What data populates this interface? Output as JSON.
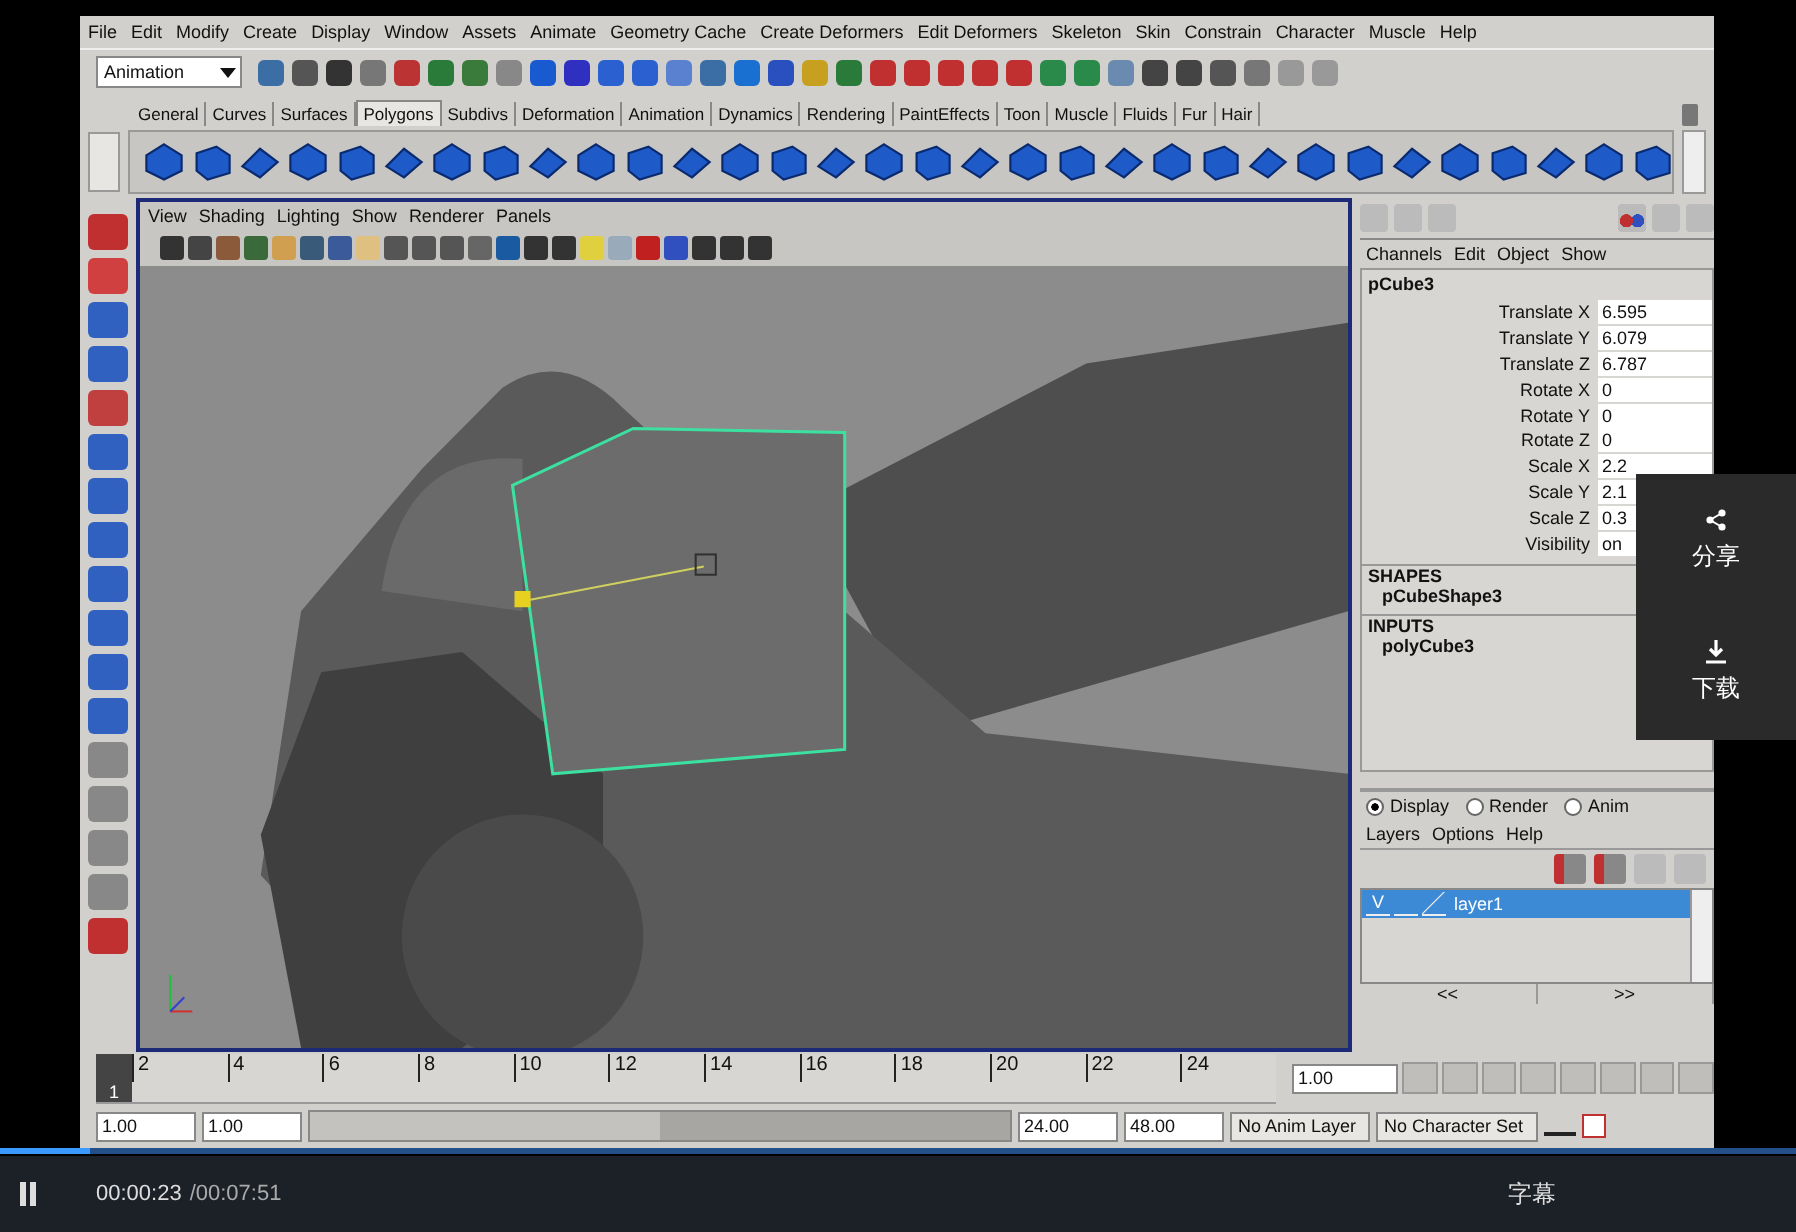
{
  "menu_bar": [
    "File",
    "Edit",
    "Modify",
    "Create",
    "Display",
    "Window",
    "Assets",
    "Animate",
    "Geometry Cache",
    "Create Deformers",
    "Edit Deformers",
    "Skeleton",
    "Skin",
    "Constrain",
    "Character",
    "Muscle",
    "Help"
  ],
  "status_line": {
    "mode": "Animation"
  },
  "shelf_tabs": [
    {
      "label": "General",
      "selected": false
    },
    {
      "label": "Curves",
      "selected": false
    },
    {
      "label": "Surfaces",
      "selected": false
    },
    {
      "label": "Polygons",
      "selected": true
    },
    {
      "label": "Subdivs",
      "selected": false
    },
    {
      "label": "Deformation",
      "selected": false
    },
    {
      "label": "Animation",
      "selected": false
    },
    {
      "label": "Dynamics",
      "selected": false
    },
    {
      "label": "Rendering",
      "selected": false
    },
    {
      "label": "PaintEffects",
      "selected": false
    },
    {
      "label": "Toon",
      "selected": false
    },
    {
      "label": "Muscle",
      "selected": false
    },
    {
      "label": "Fluids",
      "selected": false
    },
    {
      "label": "Fur",
      "selected": false
    },
    {
      "label": "Hair",
      "selected": false
    }
  ],
  "panel_menu": [
    "View",
    "Shading",
    "Lighting",
    "Show",
    "Renderer",
    "Panels"
  ],
  "channel_box": {
    "menus": [
      "Channels",
      "Edit",
      "Object",
      "Show"
    ],
    "object": "pCube3",
    "attributes": [
      {
        "name": "Translate X",
        "value": "6.595"
      },
      {
        "name": "Translate Y",
        "value": "6.079"
      },
      {
        "name": "Translate Z",
        "value": "6.787"
      },
      {
        "name": "Rotate X",
        "value": "0"
      },
      {
        "name": "Rotate Y",
        "value": "0"
      },
      {
        "name": "Rotate Z",
        "value": "0"
      },
      {
        "name": "Scale X",
        "value": "2.2"
      },
      {
        "name": "Scale Y",
        "value": "2.1"
      },
      {
        "name": "Scale Z",
        "value": "0.3"
      },
      {
        "name": "Visibility",
        "value": "on"
      }
    ],
    "shapes_heading": "SHAPES",
    "shape": "pCubeShape3",
    "inputs_heading": "INPUTS",
    "input": "polyCube3"
  },
  "layer_editor": {
    "modes": [
      {
        "label": "Display",
        "selected": true
      },
      {
        "label": "Render",
        "selected": false
      },
      {
        "label": "Anim",
        "selected": false
      }
    ],
    "menus": [
      "Layers",
      "Options",
      "Help"
    ],
    "layers": [
      {
        "name": "layer1",
        "visibility": "V",
        "selected": true
      }
    ],
    "nav": [
      "<<",
      ">>"
    ]
  },
  "time_slider": {
    "current_frame": "1",
    "ticks": [
      "2",
      "4",
      "6",
      "8",
      "10",
      "12",
      "14",
      "16",
      "18",
      "20",
      "22",
      "24"
    ],
    "current_time": "1.00"
  },
  "range_slider": {
    "level": 0.5,
    "start": "1.00",
    "playback_start": "1.00",
    "playback_end": "24.00",
    "end": "48.00",
    "anim_layer": "No Anim Layer",
    "character_set": "No Character Set"
  },
  "player": {
    "level": 0.05,
    "time": "00:00:23",
    "duration": "/00:07:51",
    "subtitles": "字幕"
  },
  "share_panel": [
    {
      "kind": "share",
      "label": "分享"
    },
    {
      "kind": "download",
      "label": "下载"
    }
  ]
}
